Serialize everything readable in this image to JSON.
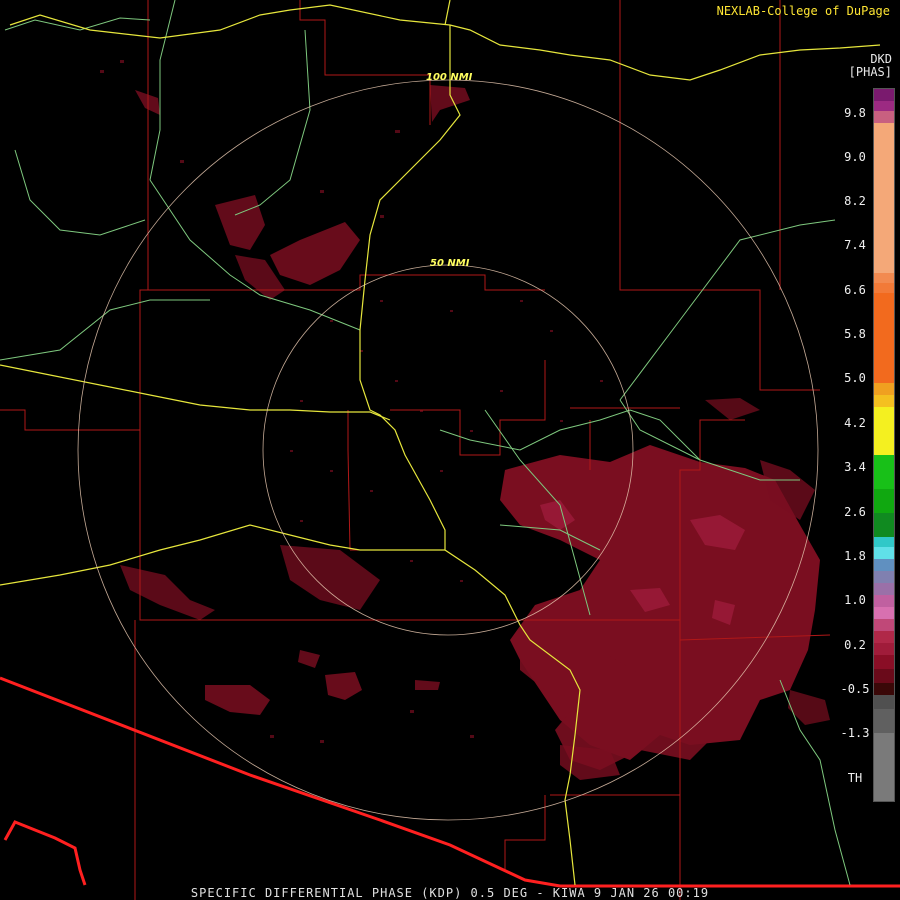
{
  "credit": "NEXLAB-College of DuPage",
  "footer": "SPECIFIC DIFFERENTIAL PHASE (KDP) 0.5 DEG - KIWA 9 JAN 26 00:19",
  "legend": {
    "unit_top": "DKD",
    "unit_bottom": "[PHAS]",
    "ticks": [
      "9.8",
      "9.0",
      "8.2",
      "7.4",
      "6.6",
      "5.8",
      "5.0",
      "4.2",
      "3.4",
      "2.6",
      "1.8",
      "1.0",
      "0.2",
      "-0.5",
      "-1.3",
      "TH"
    ]
  },
  "range_rings": [
    "100 NMI",
    "50 NMI"
  ],
  "colors": {
    "background": "#000000",
    "echo": "#7a0e20",
    "echo_light": "#9a1a38",
    "county_lines": "#b01818",
    "state_border": "#ff2020",
    "highways_major": "#e6e63c",
    "highways_minor": "#7ec87e",
    "range_ring": "#e8c8b0"
  }
}
